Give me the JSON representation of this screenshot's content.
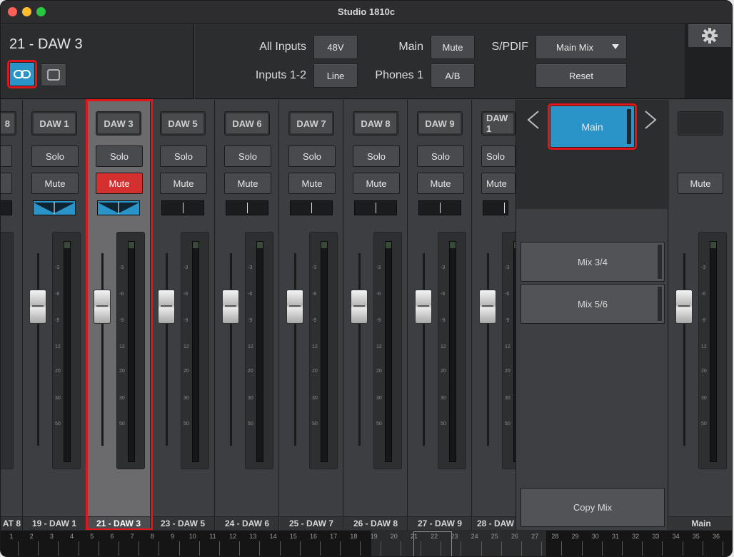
{
  "window": {
    "title": "Studio 1810c"
  },
  "header": {
    "channel_name": "21 - DAW 3",
    "all_inputs_label": "All Inputs",
    "phantom_label": "48V",
    "inputs_12_label": "Inputs 1-2",
    "line_label": "Line",
    "main_label": "Main",
    "main_mute_label": "Mute",
    "phones_label": "Phones 1",
    "ab_label": "A/B",
    "spdif_label": "S/PDIF",
    "spdif_value": "Main Mix",
    "reset_label": "Reset"
  },
  "strips": [
    {
      "header": "DAW 1",
      "name": "19 - DAW 1",
      "solo": "Solo",
      "mute": "Mute",
      "linked": true,
      "muted": false
    },
    {
      "header": "DAW 3",
      "name": "21 - DAW 3",
      "solo": "Solo",
      "mute": "Mute",
      "linked": true,
      "muted": true,
      "selected": true
    },
    {
      "header": "DAW 5",
      "name": "23 - DAW 5",
      "solo": "Solo",
      "mute": "Mute",
      "linked": false,
      "muted": false
    },
    {
      "header": "DAW 6",
      "name": "24 - DAW 6",
      "solo": "Solo",
      "mute": "Mute",
      "linked": false,
      "muted": false
    },
    {
      "header": "DAW 7",
      "name": "25 - DAW 7",
      "solo": "Solo",
      "mute": "Mute",
      "linked": false,
      "muted": false
    },
    {
      "header": "DAW 8",
      "name": "26 - DAW 8",
      "solo": "Solo",
      "mute": "Mute",
      "linked": false,
      "muted": false
    },
    {
      "header": "DAW 9",
      "name": "27 - DAW 9",
      "solo": "Solo",
      "mute": "Mute",
      "linked": false,
      "muted": false
    },
    {
      "header": "DAW 1",
      "name": "28 - DAW",
      "solo": "Solo",
      "mute": "Mute",
      "linked": false,
      "muted": false
    }
  ],
  "partial_strip": {
    "header": "8",
    "name": "AT 8"
  },
  "meter_ticks": [
    "-3",
    "-6",
    "-9",
    "12",
    "20",
    "30",
    "50"
  ],
  "mix_panel": {
    "current_mix": "Main",
    "mixes": [
      "Mix 3/4",
      "Mix 5/6"
    ],
    "copy_label": "Copy Mix"
  },
  "main_strip": {
    "mute": "Mute",
    "name": "Main"
  },
  "ruler": [
    "1",
    "2",
    "3",
    "4",
    "5",
    "6",
    "7",
    "8",
    "9",
    "10",
    "11",
    "12",
    "13",
    "14",
    "15",
    "16",
    "17",
    "18",
    "19",
    "20",
    "21",
    "22",
    "23",
    "24",
    "25",
    "26",
    "27",
    "28",
    "29",
    "30",
    "31",
    "32",
    "33",
    "34",
    "35",
    "36"
  ],
  "colors": {
    "accent_blue": "#2a94c9",
    "mute_red": "#d3302f",
    "highlight_red": "#e1161b"
  }
}
